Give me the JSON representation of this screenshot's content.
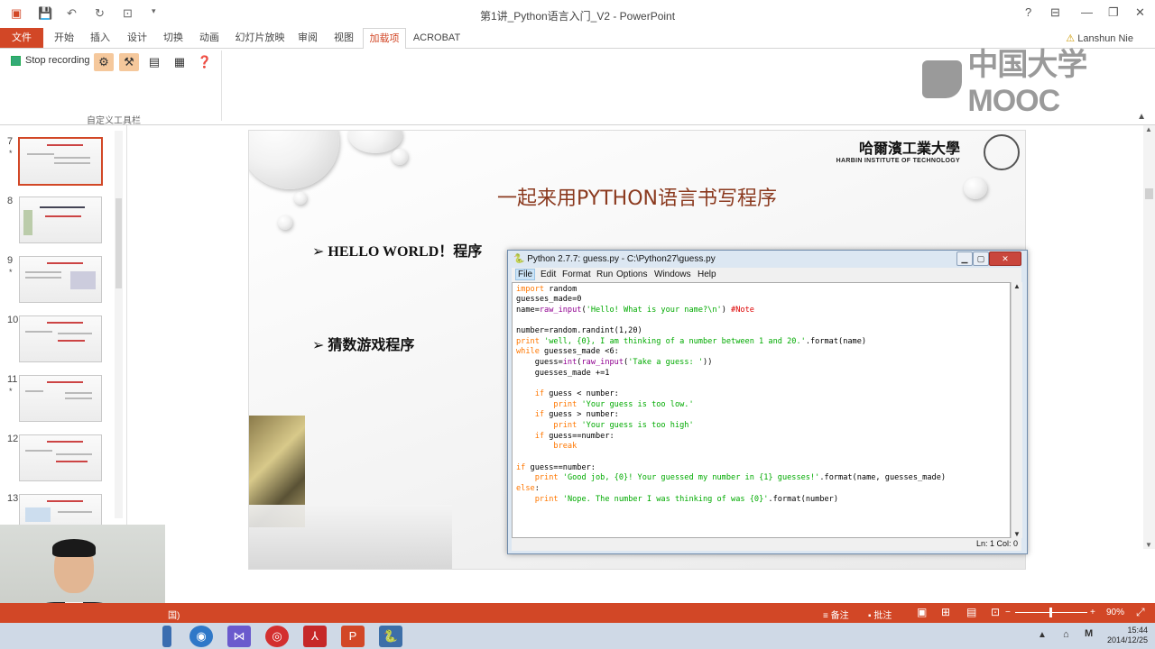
{
  "window": {
    "title": "第1讲_Python语言入门_V2 - PowerPoint",
    "help": "?",
    "user": "Lanshun Nie"
  },
  "ribbon": {
    "tabs": [
      "文件",
      "开始",
      "插入",
      "设计",
      "切换",
      "动画",
      "幻灯片放映",
      "审阅",
      "视图",
      "加载项",
      "ACROBAT"
    ],
    "active_tab": "加载项",
    "stop_recording": "Stop recording",
    "group_label": "自定义工具栏"
  },
  "branding": {
    "mooc": "中国大学MOOC"
  },
  "thumbnails": [
    {
      "num": "7",
      "star": "*"
    },
    {
      "num": "8",
      "star": ""
    },
    {
      "num": "9",
      "star": "*"
    },
    {
      "num": "10",
      "star": ""
    },
    {
      "num": "11",
      "star": "*"
    },
    {
      "num": "12",
      "star": ""
    },
    {
      "num": "13",
      "star": ""
    }
  ],
  "slide": {
    "title": "一起来用PYTHON语言书写程序",
    "bullet1": "HELLO WORLD！程序",
    "bullet2": "猜数游戏程序",
    "logo_cn": "哈爾濱工業大學",
    "logo_en": "HARBIN INSTITUTE OF TECHNOLOGY"
  },
  "idle": {
    "title": "Python 2.7.7: guess.py - C:\\Python27\\guess.py",
    "menus": [
      "File",
      "Edit",
      "Format",
      "Run",
      "Options",
      "Windows",
      "Help"
    ],
    "status": "Ln: 1 Col: 0"
  },
  "statusbar": {
    "left": "国)",
    "notes": "备注",
    "comments": "批注",
    "zoom": "90%"
  },
  "taskbar": {
    "time": "15:44",
    "date": "2014/12/25",
    "ime": "M"
  }
}
